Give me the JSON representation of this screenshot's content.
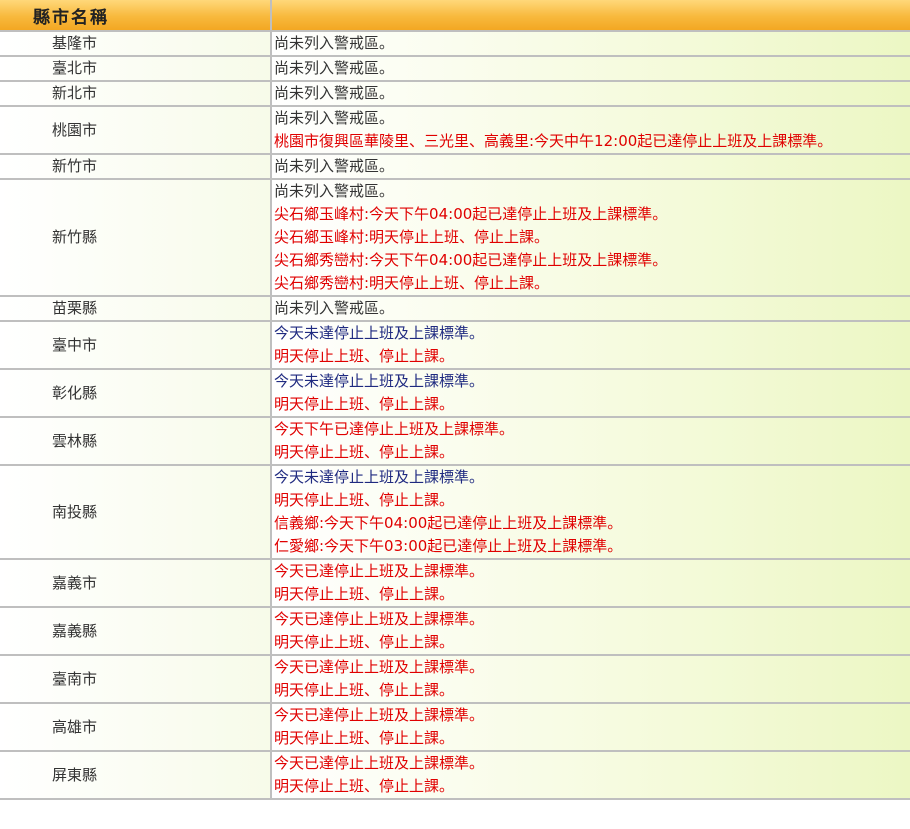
{
  "header": {
    "county_label": "縣市名稱",
    "status_label": ""
  },
  "colors": {
    "normal": "#333333",
    "blue": "#1f2a80",
    "red": "#e00000",
    "header_gold": "#f8b93d"
  },
  "rows": [
    {
      "city": "基隆市",
      "lines": [
        {
          "text": "尚未列入警戒區。",
          "color": "normal"
        }
      ]
    },
    {
      "city": "臺北市",
      "lines": [
        {
          "text": "尚未列入警戒區。",
          "color": "normal"
        }
      ]
    },
    {
      "city": "新北市",
      "lines": [
        {
          "text": "尚未列入警戒區。",
          "color": "normal"
        }
      ]
    },
    {
      "city": "桃園市",
      "lines": [
        {
          "text": "尚未列入警戒區。",
          "color": "normal"
        },
        {
          "text": "桃園市復興區華陵里、三光里、高義里:今天中午12:00起已達停止上班及上課標準。",
          "color": "red"
        }
      ]
    },
    {
      "city": "新竹市",
      "lines": [
        {
          "text": "尚未列入警戒區。",
          "color": "normal"
        }
      ]
    },
    {
      "city": "新竹縣",
      "lines": [
        {
          "text": "尚未列入警戒區。",
          "color": "normal"
        },
        {
          "text": "尖石鄉玉峰村:今天下午04:00起已達停止上班及上課標準。",
          "color": "red"
        },
        {
          "text": "尖石鄉玉峰村:明天停止上班、停止上課。",
          "color": "red"
        },
        {
          "text": "尖石鄉秀巒村:今天下午04:00起已達停止上班及上課標準。",
          "color": "red"
        },
        {
          "text": "尖石鄉秀巒村:明天停止上班、停止上課。",
          "color": "red"
        }
      ]
    },
    {
      "city": "苗栗縣",
      "lines": [
        {
          "text": "尚未列入警戒區。",
          "color": "normal"
        }
      ]
    },
    {
      "city": "臺中市",
      "lines": [
        {
          "text": "今天未達停止上班及上課標準。",
          "color": "blue"
        },
        {
          "text": "明天停止上班、停止上課。",
          "color": "red"
        }
      ]
    },
    {
      "city": "彰化縣",
      "lines": [
        {
          "text": "今天未達停止上班及上課標準。",
          "color": "blue"
        },
        {
          "text": "明天停止上班、停止上課。",
          "color": "red"
        }
      ]
    },
    {
      "city": "雲林縣",
      "lines": [
        {
          "text": "今天下午已達停止上班及上課標準。",
          "color": "red"
        },
        {
          "text": "明天停止上班、停止上課。",
          "color": "red"
        }
      ]
    },
    {
      "city": "南投縣",
      "lines": [
        {
          "text": "今天未達停止上班及上課標準。",
          "color": "blue"
        },
        {
          "text": "明天停止上班、停止上課。",
          "color": "red"
        },
        {
          "text": "信義鄉:今天下午04:00起已達停止上班及上課標準。",
          "color": "red"
        },
        {
          "text": "仁愛鄉:今天下午03:00起已達停止上班及上課標準。",
          "color": "red"
        }
      ]
    },
    {
      "city": "嘉義市",
      "lines": [
        {
          "text": "今天已達停止上班及上課標準。",
          "color": "red"
        },
        {
          "text": "明天停止上班、停止上課。",
          "color": "red"
        }
      ]
    },
    {
      "city": "嘉義縣",
      "lines": [
        {
          "text": "今天已達停止上班及上課標準。",
          "color": "red"
        },
        {
          "text": "明天停止上班、停止上課。",
          "color": "red"
        }
      ]
    },
    {
      "city": "臺南市",
      "lines": [
        {
          "text": "今天已達停止上班及上課標準。",
          "color": "red"
        },
        {
          "text": "明天停止上班、停止上課。",
          "color": "red"
        }
      ]
    },
    {
      "city": "高雄市",
      "lines": [
        {
          "text": "今天已達停止上班及上課標準。",
          "color": "red"
        },
        {
          "text": "明天停止上班、停止上課。",
          "color": "red"
        }
      ]
    },
    {
      "city": "屏東縣",
      "lines": [
        {
          "text": "今天已達停止上班及上課標準。",
          "color": "red"
        },
        {
          "text": "明天停止上班、停止上課。",
          "color": "red"
        }
      ]
    }
  ]
}
